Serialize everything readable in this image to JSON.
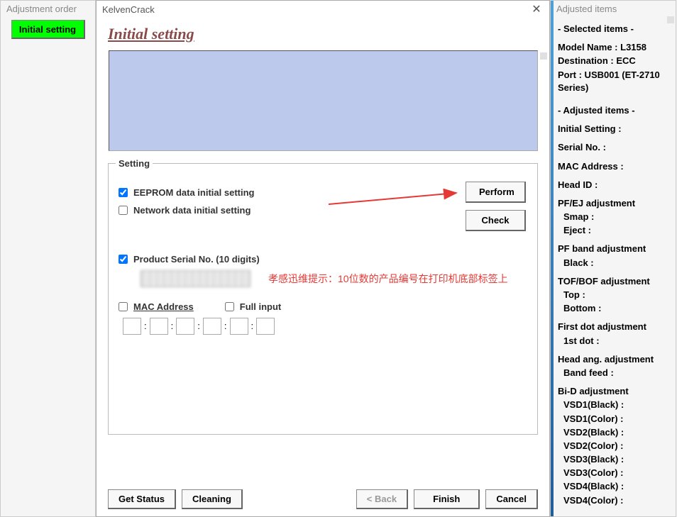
{
  "leftPanel": {
    "header": "Adjustment order",
    "initialBtn": "Initial setting"
  },
  "window": {
    "title": "KelvenCrack",
    "pageTitle": "Initial setting"
  },
  "setting": {
    "legend": "Setting",
    "eeprom": {
      "label": "EEPROM data initial setting",
      "checked": true
    },
    "network": {
      "label": "Network data initial setting",
      "checked": false
    },
    "serial": {
      "label": "Product Serial No. (10 digits)",
      "checked": true
    },
    "mac": {
      "label": "MAC Address",
      "checked": false
    },
    "fullInput": {
      "label": "Full input",
      "checked": false
    },
    "performBtn": "Perform",
    "checkBtn": "Check"
  },
  "annotation": "孝感迅维提示：10位数的产品编号在打印机底部标签上",
  "bottom": {
    "getStatus": "Get Status",
    "cleaning": "Cleaning",
    "back": "< Back",
    "finish": "Finish",
    "cancel": "Cancel"
  },
  "rightPanel": {
    "header": "Adjusted items",
    "selectedHdr": "- Selected items -",
    "modelName": "Model Name : L3158",
    "destination": "Destination : ECC",
    "port1": "Port : USB001 (ET-2710",
    "port2": " Series)",
    "adjustedHdr": "- Adjusted items -",
    "items": [
      {
        "t": "Initial Setting :",
        "sub": []
      },
      {
        "t": "Serial No. :",
        "sub": []
      },
      {
        "t": "MAC Address :",
        "sub": []
      },
      {
        "t": "Head ID :",
        "sub": []
      },
      {
        "t": "PF/EJ adjustment",
        "sub": [
          "Smap :",
          "Eject :"
        ]
      },
      {
        "t": "PF band adjustment",
        "sub": [
          "Black :"
        ]
      },
      {
        "t": "TOF/BOF adjustment",
        "sub": [
          "Top :",
          "Bottom :"
        ]
      },
      {
        "t": "First dot adjustment",
        "sub": [
          "1st dot :"
        ]
      },
      {
        "t": "Head ang. adjustment",
        "sub": [
          "Band feed :"
        ]
      },
      {
        "t": "Bi-D adjustment",
        "sub": [
          "VSD1(Black) :",
          "VSD1(Color) :",
          "VSD2(Black) :",
          "VSD2(Color) :",
          "VSD3(Black) :",
          "VSD3(Color) :",
          "VSD4(Black) :",
          "VSD4(Color) :"
        ]
      }
    ]
  }
}
